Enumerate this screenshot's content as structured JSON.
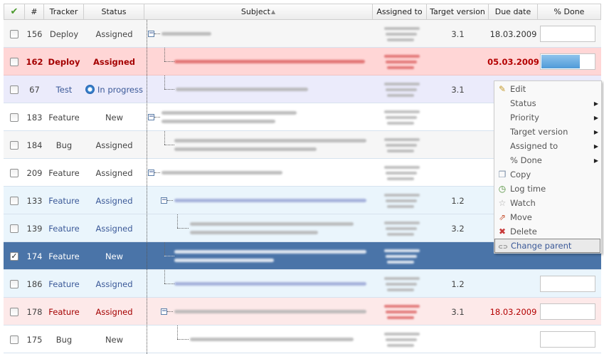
{
  "header": {
    "check_icon": "checkmark-icon",
    "id": "#",
    "tracker": "Tracker",
    "status": "Status",
    "subject": "Subject",
    "assigned_to": "Assigned to",
    "target_version": "Target version",
    "due_date": "Due date",
    "done": "% Done"
  },
  "rows": [
    {
      "id": "156",
      "tracker": "Deploy",
      "status": "Assigned",
      "version": "3.1",
      "due": "18.03.2009",
      "checked": false,
      "done": 0
    },
    {
      "id": "162",
      "tracker": "Deploy",
      "status": "Assigned",
      "version": "",
      "due": "05.03.2009",
      "checked": false,
      "done": 71
    },
    {
      "id": "67",
      "tracker": "Test",
      "status": "In progress",
      "version": "3.1",
      "due": "",
      "checked": false
    },
    {
      "id": "183",
      "tracker": "Feature",
      "status": "New",
      "version": "",
      "due": "",
      "checked": false
    },
    {
      "id": "184",
      "tracker": "Bug",
      "status": "Assigned",
      "version": "",
      "due": "",
      "checked": false
    },
    {
      "id": "209",
      "tracker": "Feature",
      "status": "Assigned",
      "version": "",
      "due": "",
      "checked": false
    },
    {
      "id": "133",
      "tracker": "Feature",
      "status": "Assigned",
      "version": "1.2",
      "due": "",
      "checked": false
    },
    {
      "id": "139",
      "tracker": "Feature",
      "status": "Assigned",
      "version": "3.2",
      "due": "",
      "checked": false
    },
    {
      "id": "174",
      "tracker": "Feature",
      "status": "New",
      "version": "",
      "due": "",
      "checked": true
    },
    {
      "id": "186",
      "tracker": "Feature",
      "status": "Assigned",
      "version": "1.2",
      "due": "",
      "checked": false,
      "done": 0
    },
    {
      "id": "178",
      "tracker": "Feature",
      "status": "Assigned",
      "version": "3.1",
      "due": "18.03.2009",
      "checked": false,
      "done": 0
    },
    {
      "id": "175",
      "tracker": "Bug",
      "status": "New",
      "version": "",
      "due": "",
      "checked": false,
      "done": 0
    }
  ],
  "context_menu": {
    "items": [
      {
        "label": "Edit",
        "icon": "pencil-icon"
      },
      {
        "label": "Status",
        "submenu": true
      },
      {
        "label": "Priority",
        "submenu": true
      },
      {
        "label": "Target version",
        "submenu": true
      },
      {
        "label": "Assigned to",
        "submenu": true
      },
      {
        "label": "% Done",
        "submenu": true
      },
      {
        "label": "Copy",
        "icon": "copy-icon"
      },
      {
        "label": "Log time",
        "icon": "clock-icon"
      },
      {
        "label": "Watch",
        "icon": "star-icon"
      },
      {
        "label": "Move",
        "icon": "move-icon"
      },
      {
        "label": "Delete",
        "icon": "delete-icon"
      },
      {
        "label": "Change parent",
        "icon": "link-icon",
        "highlighted": true
      }
    ]
  },
  "colors": {
    "selected_row": "#4a74a8",
    "overdue_row": "#ffd6d6",
    "overdue_text": "#a40000",
    "progress_fill": "#4f9bd8",
    "link_text": "#3b5998"
  }
}
